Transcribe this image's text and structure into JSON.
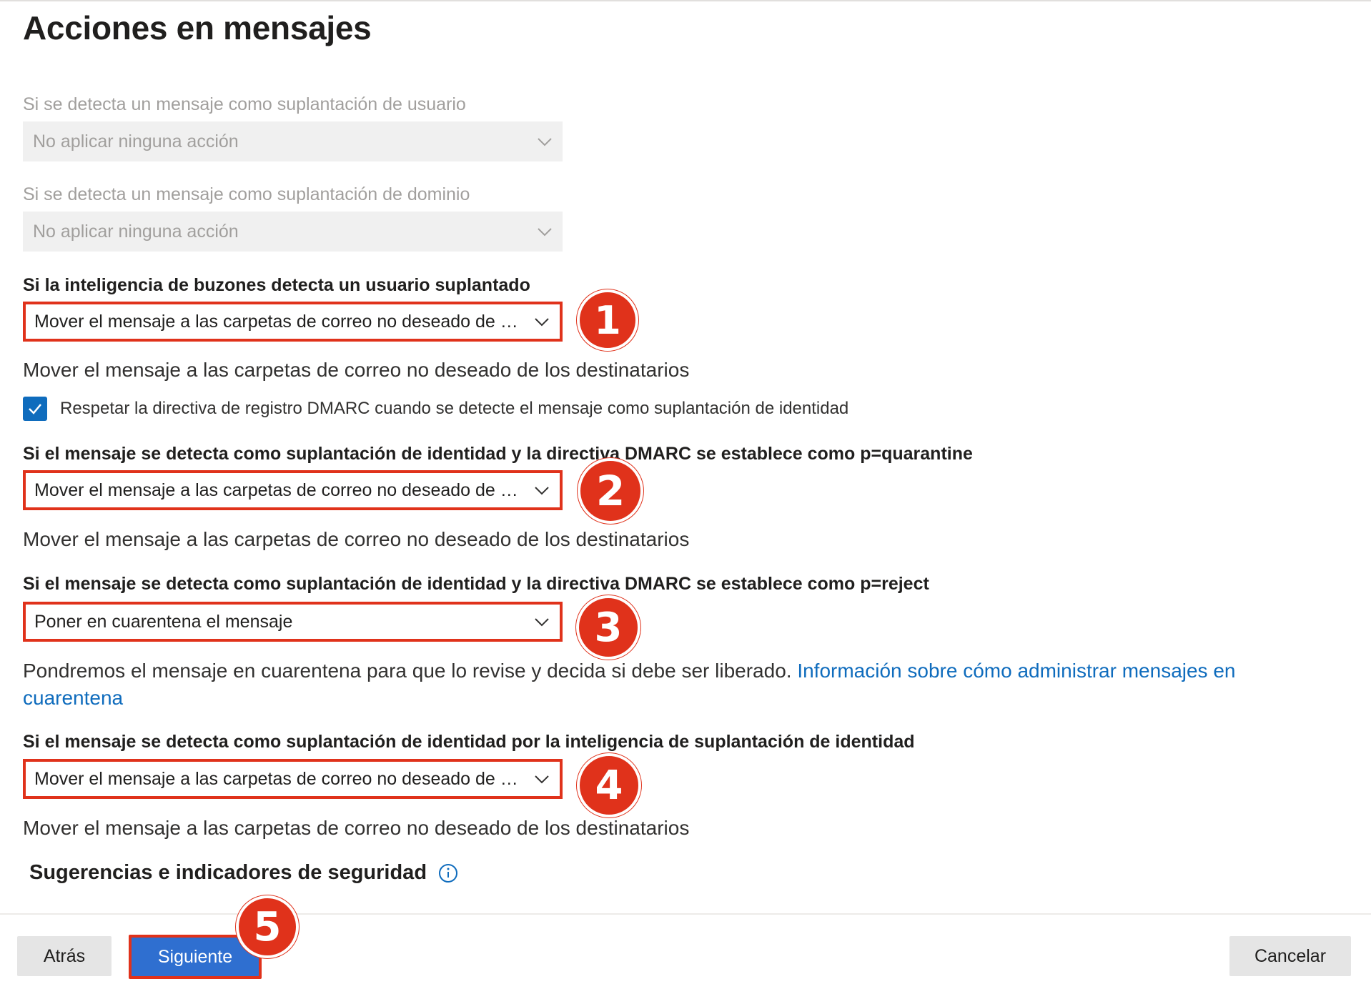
{
  "page": {
    "title": "Acciones en mensajes"
  },
  "fields": {
    "user_impersonation": {
      "label": "Si se detecta un mensaje como suplantación de usuario",
      "value": "No aplicar ninguna acción"
    },
    "domain_impersonation": {
      "label": "Si se detecta un mensaje como suplantación de dominio",
      "value": "No aplicar ninguna acción"
    },
    "mailbox_intelligence": {
      "label": "Si la inteligencia de buzones detecta un usuario suplantado",
      "value": "Mover el mensaje a las carpetas de correo no deseado de lo...",
      "description": "Mover el mensaje a las carpetas de correo no deseado de los destinatarios",
      "badge": "1"
    },
    "honor_dmarc": {
      "label": "Respetar la directiva de registro DMARC cuando se detecte el mensaje como suplantación de identidad",
      "checked": true
    },
    "dmarc_quarantine": {
      "label": "Si el mensaje se detecta como suplantación de identidad y la directiva DMARC se establece como p=quarantine",
      "value": "Mover el mensaje a las carpetas de correo no deseado de lo...",
      "description": "Mover el mensaje a las carpetas de correo no deseado de los destinatarios",
      "badge": "2"
    },
    "dmarc_reject": {
      "label": "Si el mensaje se detecta como suplantación de identidad y la directiva DMARC se establece como p=reject",
      "value": "Poner en cuarentena el mensaje",
      "description": "Pondremos el mensaje en cuarentena para que lo revise y decida si debe ser liberado.",
      "link": "Información sobre cómo administrar mensajes en cuarentena",
      "badge": "3"
    },
    "spoof_intelligence": {
      "label": "Si el mensaje se detecta como suplantación de identidad por la inteligencia de suplantación de identidad",
      "value": "Mover el mensaje a las carpetas de correo no deseado de lo...",
      "description": "Mover el mensaje a las carpetas de correo no deseado de los destinatarios",
      "badge": "4"
    }
  },
  "safety_tips": {
    "title": "Sugerencias e indicadores de seguridad"
  },
  "footer": {
    "back_label": "Atrás",
    "next_label": "Siguiente",
    "cancel_label": "Cancelar",
    "next_badge": "5"
  },
  "colors": {
    "highlight": "#e0321b",
    "accent": "#0f6cbd",
    "primary_button": "#2f6fd0"
  },
  "icons": [
    "chevron-down-icon",
    "checkmark-icon",
    "info-icon"
  ]
}
